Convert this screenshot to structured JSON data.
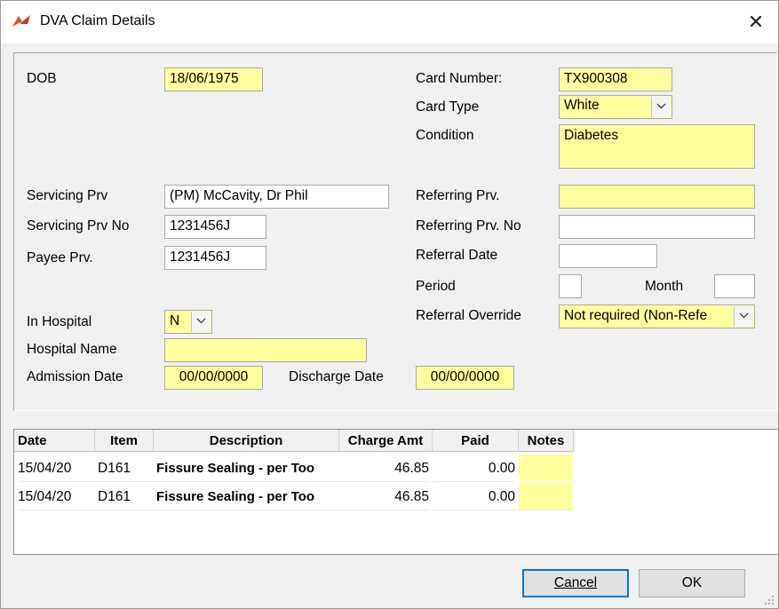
{
  "window": {
    "title": "DVA Claim Details",
    "close_glyph": "✕",
    "icon": "app-logo-icon",
    "accent_color": "#e04a2a"
  },
  "form": {
    "dob": {
      "label": "DOB",
      "value": "18/06/1975"
    },
    "card_number": {
      "label": "Card Number:",
      "value": "TX900308"
    },
    "card_type": {
      "label": "Card Type",
      "value": "White"
    },
    "condition": {
      "label": "Condition",
      "value": "Diabetes"
    },
    "servicing_prv": {
      "label": "Servicing Prv",
      "value": "(PM) McCavity, Dr Phil"
    },
    "servicing_prv_no": {
      "label": "Servicing Prv No",
      "value": "1231456J"
    },
    "payee_prv": {
      "label": "Payee Prv.",
      "value": "1231456J"
    },
    "referring_prv": {
      "label": "Referring Prv.",
      "value": ""
    },
    "referring_prv_no": {
      "label": "Referring Prv. No",
      "value": ""
    },
    "referral_date": {
      "label": "Referral Date",
      "value": ""
    },
    "period": {
      "label": "Period",
      "value": ""
    },
    "month": {
      "label": "Month",
      "value": ""
    },
    "referral_override": {
      "label": "Referral Override",
      "value": "Not required (Non-Refe"
    },
    "in_hospital": {
      "label": "In Hospital",
      "value": "N"
    },
    "hospital_name": {
      "label": "Hospital Name",
      "value": ""
    },
    "admission_date": {
      "label": "Admission Date",
      "value": "00/00/0000"
    },
    "discharge_date": {
      "label": "Discharge Date",
      "value": "00/00/0000"
    }
  },
  "grid": {
    "columns": [
      "Date",
      "Item",
      "Description",
      "Charge Amt",
      "Paid",
      "Notes"
    ],
    "rows": [
      {
        "date": "15/04/20",
        "item": "D161",
        "description": "Fissure Sealing - per Too",
        "charge": "46.85",
        "paid": "0.00",
        "notes": ""
      },
      {
        "date": "15/04/20",
        "item": "D161",
        "description": "Fissure Sealing - per Too",
        "charge": "46.85",
        "paid": "0.00",
        "notes": ""
      }
    ]
  },
  "buttons": {
    "cancel_label": "Cancel",
    "ok_label": "OK"
  }
}
